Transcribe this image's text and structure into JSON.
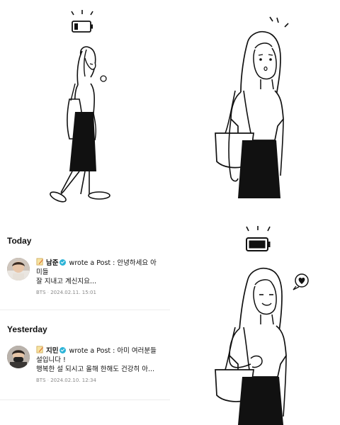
{
  "feed": {
    "today_label": "Today",
    "yesterday_label": "Yesterday",
    "items": [
      {
        "author": "남준",
        "verb": "wrote a Post :",
        "text_line1": "안녕하세요 아",
        "text_line2": "미들",
        "text_line3": "잘 지내고 계신지요...",
        "source": "BTS",
        "timestamp": "2024.02.11. 15:01"
      },
      {
        "author": "지민",
        "verb": "wrote a Post :",
        "text_line1": "아미 여러분들",
        "text_line2": "설입니다 !",
        "text_line3": "행복한 설 되시고 올해 한해도 건강히 아...",
        "source": "BTS",
        "timestamp": "2024.02.10. 12:34"
      }
    ]
  },
  "illustrations": {
    "panel1": {
      "battery_level": 0.25,
      "battery_color": "#111111"
    },
    "panel3": {
      "battery_level": 1.0,
      "battery_color": "#111111",
      "bubble_icon": "heart-icon"
    },
    "panel2": {
      "emote_icon": "surprise-lines-icon"
    }
  },
  "colors": {
    "verified": "#2bb3d7",
    "ink": "#111111",
    "meta": "#8a8a8a"
  }
}
